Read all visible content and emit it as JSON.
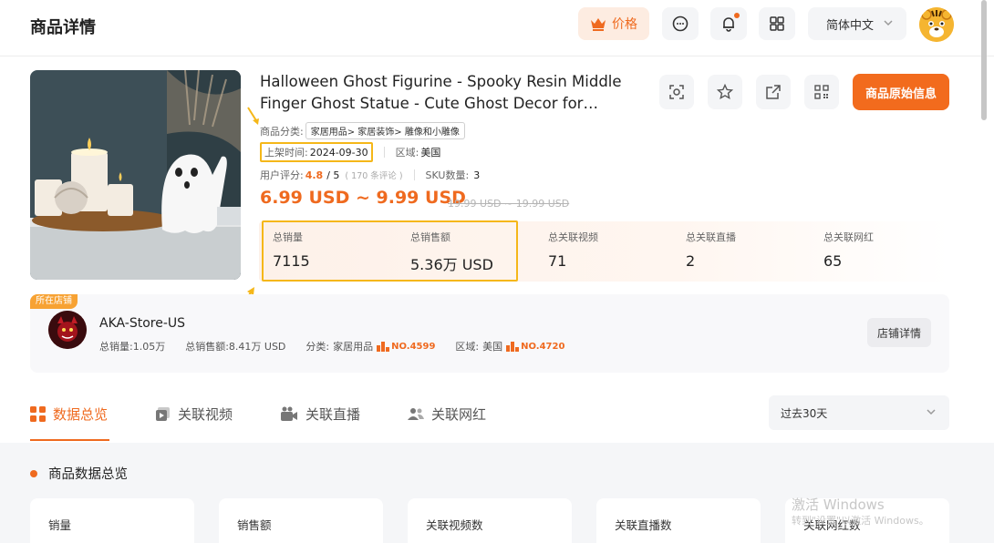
{
  "header": {
    "title": "商品详情",
    "vip_label": "价格",
    "language": "简体中文"
  },
  "product": {
    "title": "Halloween Ghost Figurine - Spooky Resin Middle Finger Ghost Statue - Cute Ghost Decor for…",
    "original_info_button": "商品原始信息",
    "category_label": "商品分类:",
    "category_value": "家居用品> 家居装饰> 雕像和小雕像",
    "listing_label": "上架时间:",
    "listing_date": "2024-09-30",
    "region_label": "区域:",
    "region_value": "美国",
    "rating_label": "用户评分:",
    "rating_value": "4.8",
    "rating_max": "/ 5",
    "review_count": "( 170 条评论 )",
    "sku_label": "SKU数量:",
    "sku_value": "3",
    "price": "6.99 USD ~ 9.99 USD",
    "price_original": "19.99 USD ~ 19.99 USD"
  },
  "stats": [
    {
      "label": "总销量",
      "value": "7115"
    },
    {
      "label": "总销售额",
      "value": "5.36万 USD"
    },
    {
      "label": "总关联视频",
      "value": "71"
    },
    {
      "label": "总关联直播",
      "value": "2"
    },
    {
      "label": "总关联网红",
      "value": "65"
    }
  ],
  "store": {
    "tag": "所在店铺",
    "name": "AKA-Store-US",
    "total_sales": "总销量:1.05万",
    "total_revenue": "总销售额:8.41万 USD",
    "category_label": "分类:",
    "category_value": "家居用品",
    "category_rank": "NO.4599",
    "region_label": "区域:",
    "region_value": "美国",
    "region_rank": "NO.4720",
    "detail_button": "店铺详情"
  },
  "tabs": [
    {
      "label": "数据总览",
      "active": true
    },
    {
      "label": "关联视频",
      "active": false
    },
    {
      "label": "关联直播",
      "active": false
    },
    {
      "label": "关联网红",
      "active": false
    }
  ],
  "time_range": "过去30天",
  "overview": {
    "title": "商品数据总览",
    "cards": [
      "销量",
      "销售额",
      "关联视频数",
      "关联直播数",
      "关联网红数"
    ]
  },
  "watermark": {
    "line1": "激活 Windows",
    "line2": "转到\"设置\"以激活 Windows。"
  },
  "colors": {
    "accent": "#ef6a1f",
    "highlight": "#f5b719"
  }
}
